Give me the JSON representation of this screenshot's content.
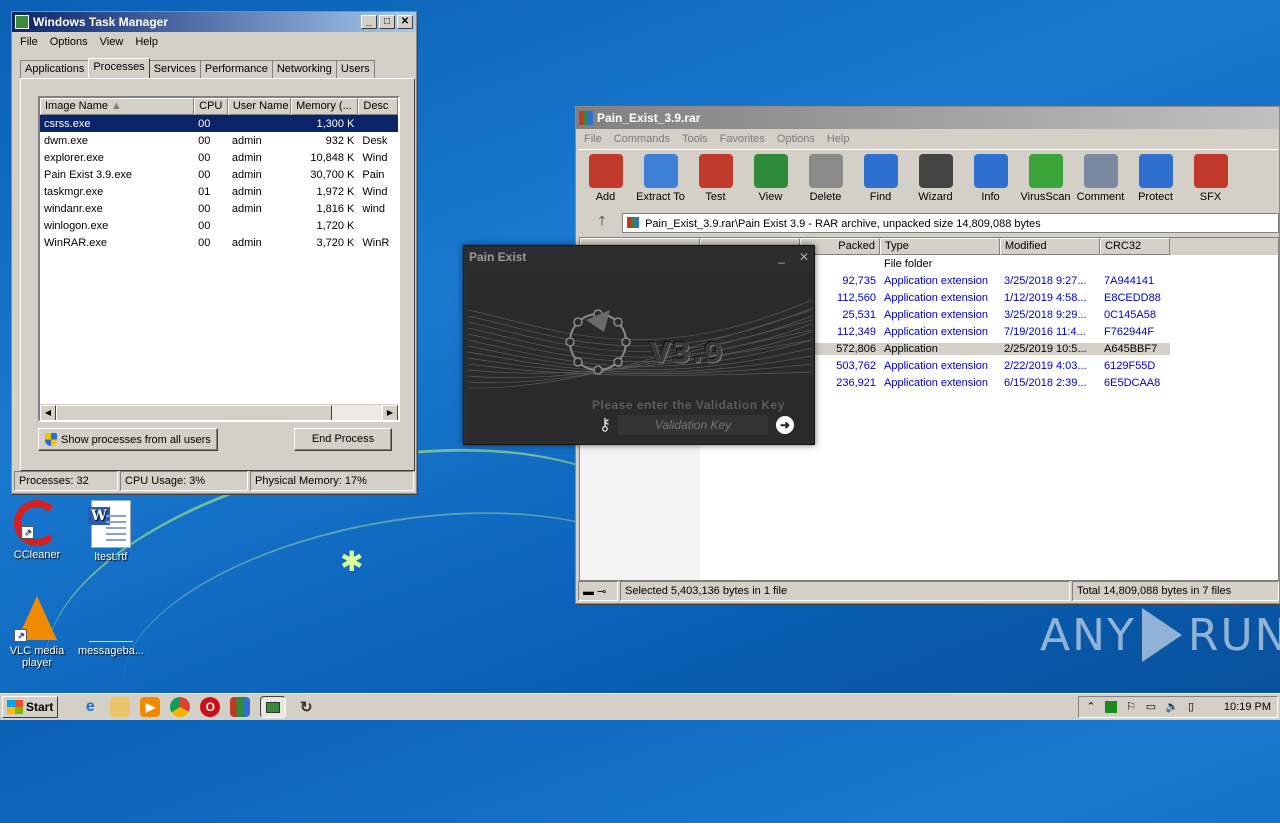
{
  "desktop": {
    "icons": [
      {
        "label": "CCleaner"
      },
      {
        "label": "ltest.rtf"
      },
      {
        "label": "VLC media player"
      },
      {
        "label": "messageba..."
      }
    ],
    "watermark": {
      "left": "ANY",
      "right": "RUN"
    }
  },
  "task_manager": {
    "title": "Windows Task Manager",
    "menu": [
      "File",
      "Options",
      "View",
      "Help"
    ],
    "tabs": [
      "Applications",
      "Processes",
      "Services",
      "Performance",
      "Networking",
      "Users"
    ],
    "active_tab": "Processes",
    "columns": [
      "Image Name",
      "CPU",
      "User Name",
      "Memory (...",
      "Desc"
    ],
    "rows": [
      {
        "name": "csrss.exe",
        "cpu": "00",
        "user": "",
        "mem": "1,300 K",
        "desc": ""
      },
      {
        "name": "dwm.exe",
        "cpu": "00",
        "user": "admin",
        "mem": "932 K",
        "desc": "Desk"
      },
      {
        "name": "explorer.exe",
        "cpu": "00",
        "user": "admin",
        "mem": "10,848 K",
        "desc": "Wind"
      },
      {
        "name": "Pain Exist 3.9.exe",
        "cpu": "00",
        "user": "admin",
        "mem": "30,700 K",
        "desc": "Pain"
      },
      {
        "name": "taskmgr.exe",
        "cpu": "01",
        "user": "admin",
        "mem": "1,972 K",
        "desc": "Wind"
      },
      {
        "name": "windanr.exe",
        "cpu": "00",
        "user": "admin",
        "mem": "1,816 K",
        "desc": "wind"
      },
      {
        "name": "winlogon.exe",
        "cpu": "00",
        "user": "",
        "mem": "1,720 K",
        "desc": ""
      },
      {
        "name": "WinRAR.exe",
        "cpu": "00",
        "user": "admin",
        "mem": "3,720 K",
        "desc": "WinR"
      }
    ],
    "show_all_label": "Show processes from all users",
    "end_process_label": "End Process",
    "status": {
      "processes": "Processes: 32",
      "cpu": "CPU Usage: 3%",
      "memory": "Physical Memory: 17%"
    }
  },
  "winrar": {
    "title": "Pain_Exist_3.9.rar",
    "menu": [
      "File",
      "Commands",
      "Tools",
      "Favorites",
      "Options",
      "Help"
    ],
    "toolbar": [
      {
        "label": "Add",
        "icon": "add-icon",
        "color": "#c0392b"
      },
      {
        "label": "Extract To",
        "icon": "extract-folder-icon",
        "color": "#3d7fd6"
      },
      {
        "label": "Test",
        "icon": "test-checklist-icon",
        "color": "#c0392b"
      },
      {
        "label": "View",
        "icon": "view-book-icon",
        "color": "#2e8b3a"
      },
      {
        "label": "Delete",
        "icon": "delete-trash-icon",
        "color": "#8a8a8a"
      },
      {
        "label": "Find",
        "icon": "find-magnifier-icon",
        "color": "#2f6fcf"
      },
      {
        "label": "Wizard",
        "icon": "wizard-wand-icon",
        "color": "#444444"
      },
      {
        "label": "Info",
        "icon": "info-icon",
        "color": "#2f6fcf"
      },
      {
        "label": "VirusScan",
        "icon": "virusscan-icon",
        "color": "#3aa33a"
      },
      {
        "label": "Comment",
        "icon": "comment-icon",
        "color": "#7a8aa0"
      },
      {
        "label": "Protect",
        "icon": "protect-shield-icon",
        "color": "#2f6fcf"
      },
      {
        "label": "SFX",
        "icon": "sfx-icon",
        "color": "#c0392b"
      }
    ],
    "path": "Pain_Exist_3.9.rar\\Pain Exist 3.9 - RAR archive, unpacked size 14,809,088 bytes",
    "columns": [
      "Packed",
      "Type",
      "Modified",
      "CRC32"
    ],
    "rows": [
      {
        "packed": "",
        "type": "File folder",
        "modified": "",
        "crc": ""
      },
      {
        "packed": "92,735",
        "type": "Application extension",
        "modified": "3/25/2018 9:27...",
        "crc": "7A944141"
      },
      {
        "packed": "112,560",
        "type": "Application extension",
        "modified": "1/12/2019 4:58...",
        "crc": "E8CEDD88"
      },
      {
        "packed": "25,531",
        "type": "Application extension",
        "modified": "3/25/2018 9:29...",
        "crc": "0C145A58"
      },
      {
        "packed": "112,349",
        "type": "Application extension",
        "modified": "7/19/2016 11:4...",
        "crc": "F762944F"
      },
      {
        "packed": "572,806",
        "type": "Application",
        "modified": "2/25/2019 10:5...",
        "crc": "A645BBF7"
      },
      {
        "packed": "503,762",
        "type": "Application extension",
        "modified": "2/22/2019 4:03...",
        "crc": "6129F55D"
      },
      {
        "packed": "236,921",
        "type": "Application extension",
        "modified": "6/15/2018 2:39...",
        "crc": "6E5DCAA8"
      }
    ],
    "status_left": "Selected 5,403,136 bytes in 1 file",
    "status_right": "Total 14,809,088 bytes in 7 files"
  },
  "pain_exist": {
    "title": "Pain Exist",
    "version": "V3.9",
    "prompt": "Please enter the Validation Key",
    "input_placeholder": "Validation Key"
  },
  "taskbar": {
    "start_label": "Start",
    "clock": "10:19 PM"
  }
}
